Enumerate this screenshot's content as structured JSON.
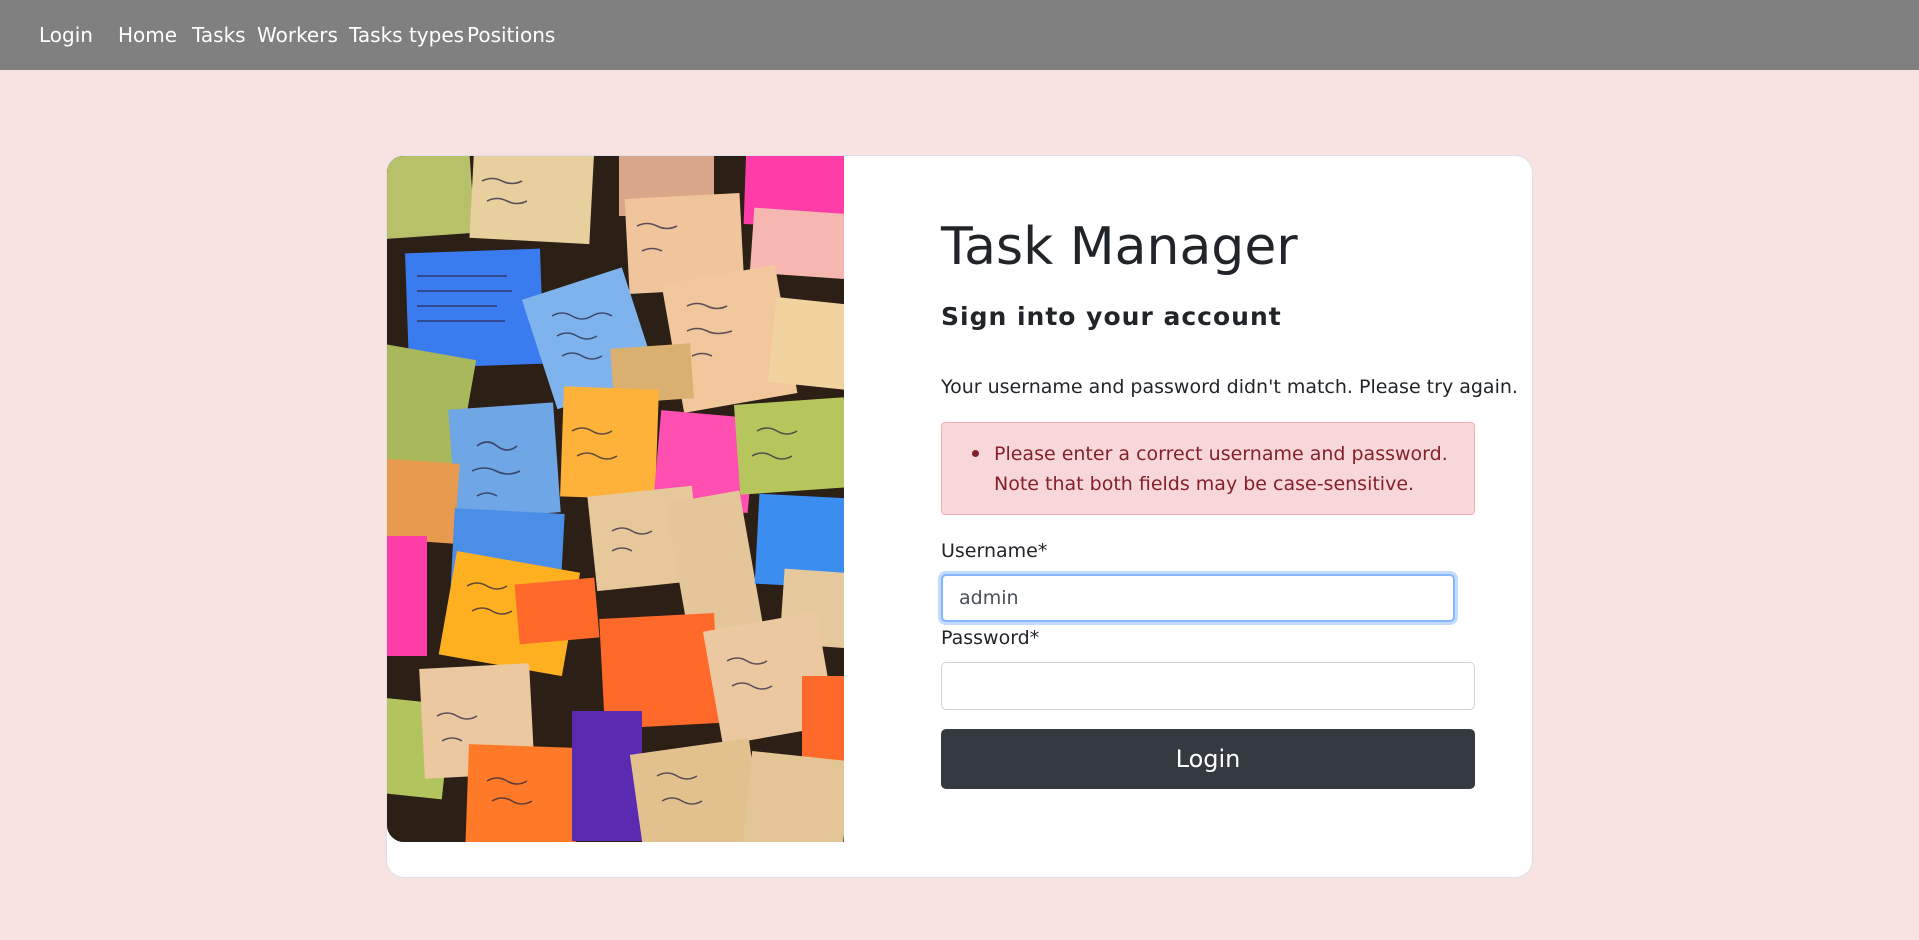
{
  "nav": {
    "brand": "Login",
    "items": [
      "Home",
      "Tasks",
      "Workers",
      "Tasks types",
      "Positions"
    ]
  },
  "login": {
    "title": "Task Manager",
    "subtitle": "Sign into your account",
    "error_message": "Your username and password didn't match. Please try again.",
    "alert_line1": "Please enter a correct username and password.",
    "alert_line2": "Note that both fields may be case-sensitive.",
    "username_label": "Username*",
    "username_value": "admin",
    "password_label": "Password*",
    "password_value": "",
    "submit_label": "Login"
  },
  "image": {
    "description_icon": "sticky-notes-photo"
  },
  "colors": {
    "navbar": "#808080",
    "page_background": "#f8e2e2",
    "button": "#343a40",
    "alert_background": "#f8d7da",
    "alert_text": "#842029"
  }
}
